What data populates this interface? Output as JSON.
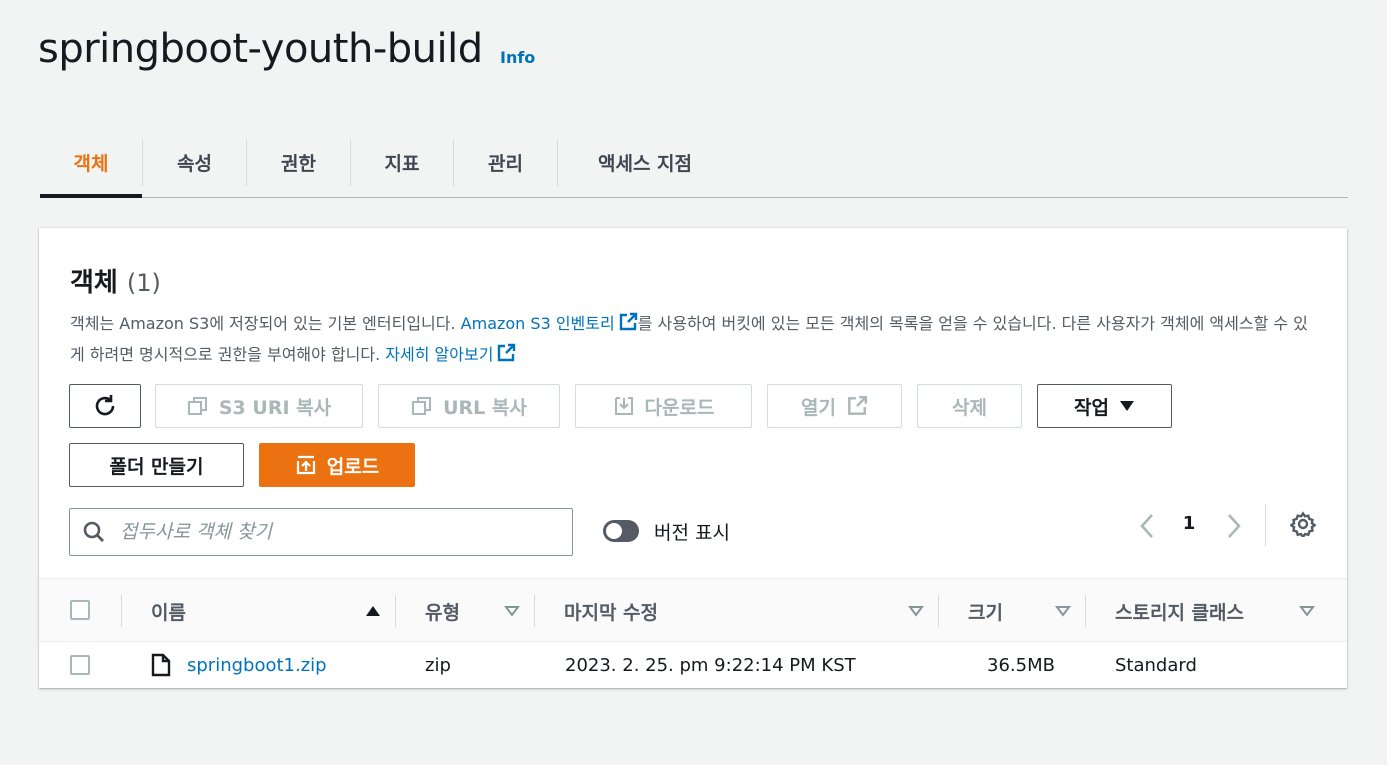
{
  "page": {
    "title": "springboot-youth-build",
    "info": "Info"
  },
  "tabs": [
    {
      "label": "객체",
      "active": true
    },
    {
      "label": "속성"
    },
    {
      "label": "권한"
    },
    {
      "label": "지표"
    },
    {
      "label": "관리"
    },
    {
      "label": "액세스 지점"
    }
  ],
  "objects": {
    "title": "객체",
    "count": "(1)",
    "desc_part1": "객체는 Amazon S3에 저장되어 있는 기본 엔터티입니다. ",
    "desc_link1": "Amazon S3 인벤토리",
    "desc_part2": "를 사용하여 버킷에 있는 모든 객체의 목록을 얻을 수 있습니다. 다른 사용자가 객체에 액세스할 수 있게 하려면 명시적으로 권한을 부여해야 합니다. ",
    "desc_link2": "자세히 알아보기"
  },
  "toolbar": {
    "copy_s3_uri": "S3 URI 복사",
    "copy_url": "URL 복사",
    "download": "다운로드",
    "open": "열기",
    "delete": "삭제",
    "actions": "작업",
    "create_folder": "폴더 만들기",
    "upload": "업로드"
  },
  "search": {
    "placeholder": "접두사로 객체 찾기"
  },
  "versions": {
    "label": "버전 표시"
  },
  "pagination": {
    "page": "1"
  },
  "table": {
    "columns": [
      "이름",
      "유형",
      "마지막 수정",
      "크기",
      "스토리지 클래스"
    ],
    "rows": [
      {
        "name": "springboot1.zip",
        "type": "zip",
        "modified": "2023. 2. 25. pm 9:22:14 PM KST",
        "size": "36.5MB",
        "storage": "Standard"
      }
    ]
  },
  "colors": {
    "accent": "#ec7211",
    "link": "#0073bb",
    "text": "#16191f"
  }
}
